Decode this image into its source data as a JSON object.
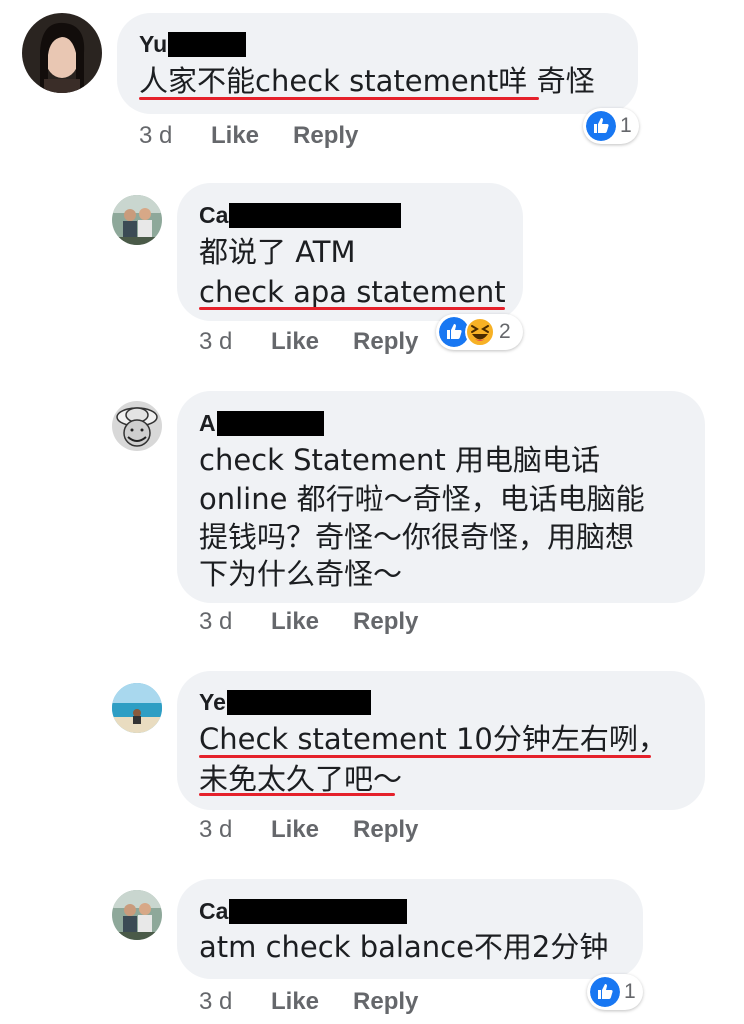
{
  "comments": [
    {
      "author": "Yu",
      "lines": [
        "人家不能check statement咩 奇怪"
      ],
      "time": "3 d",
      "like": "Like",
      "reply": "Reply",
      "reaction_count": "1"
    },
    {
      "author": "Ca",
      "lines": [
        "都说了 ATM",
        "check apa statement"
      ],
      "time": "3 d",
      "like": "Like",
      "reply": "Reply",
      "reaction_count": "2"
    },
    {
      "author": "A",
      "lines": [
        "check Statement 用电脑电话",
        "online 都行啦～奇怪，电话电脑能",
        "提钱吗？奇怪～你很奇怪，用脑想",
        "下为什么奇怪～"
      ],
      "time": "3 d",
      "like": "Like",
      "reply": "Reply"
    },
    {
      "author": "Ye",
      "lines": [
        "Check statement 10分钟左右咧，",
        "未免太久了吧～"
      ],
      "time": "3 d",
      "like": "Like",
      "reply": "Reply"
    },
    {
      "author": "Ca",
      "lines": [
        "atm check balance不用2分钟"
      ],
      "time": "3 d",
      "like": "Like",
      "reply": "Reply",
      "reaction_count": "1"
    }
  ],
  "colors": {
    "bubble": "#f0f2f5",
    "underline": "#e5212b",
    "like_blue": "#1877f2",
    "haha_yellow": "#f7b125",
    "meta_gray": "#65676b"
  },
  "icons": [
    "like-reaction-icon",
    "haha-reaction-icon"
  ]
}
